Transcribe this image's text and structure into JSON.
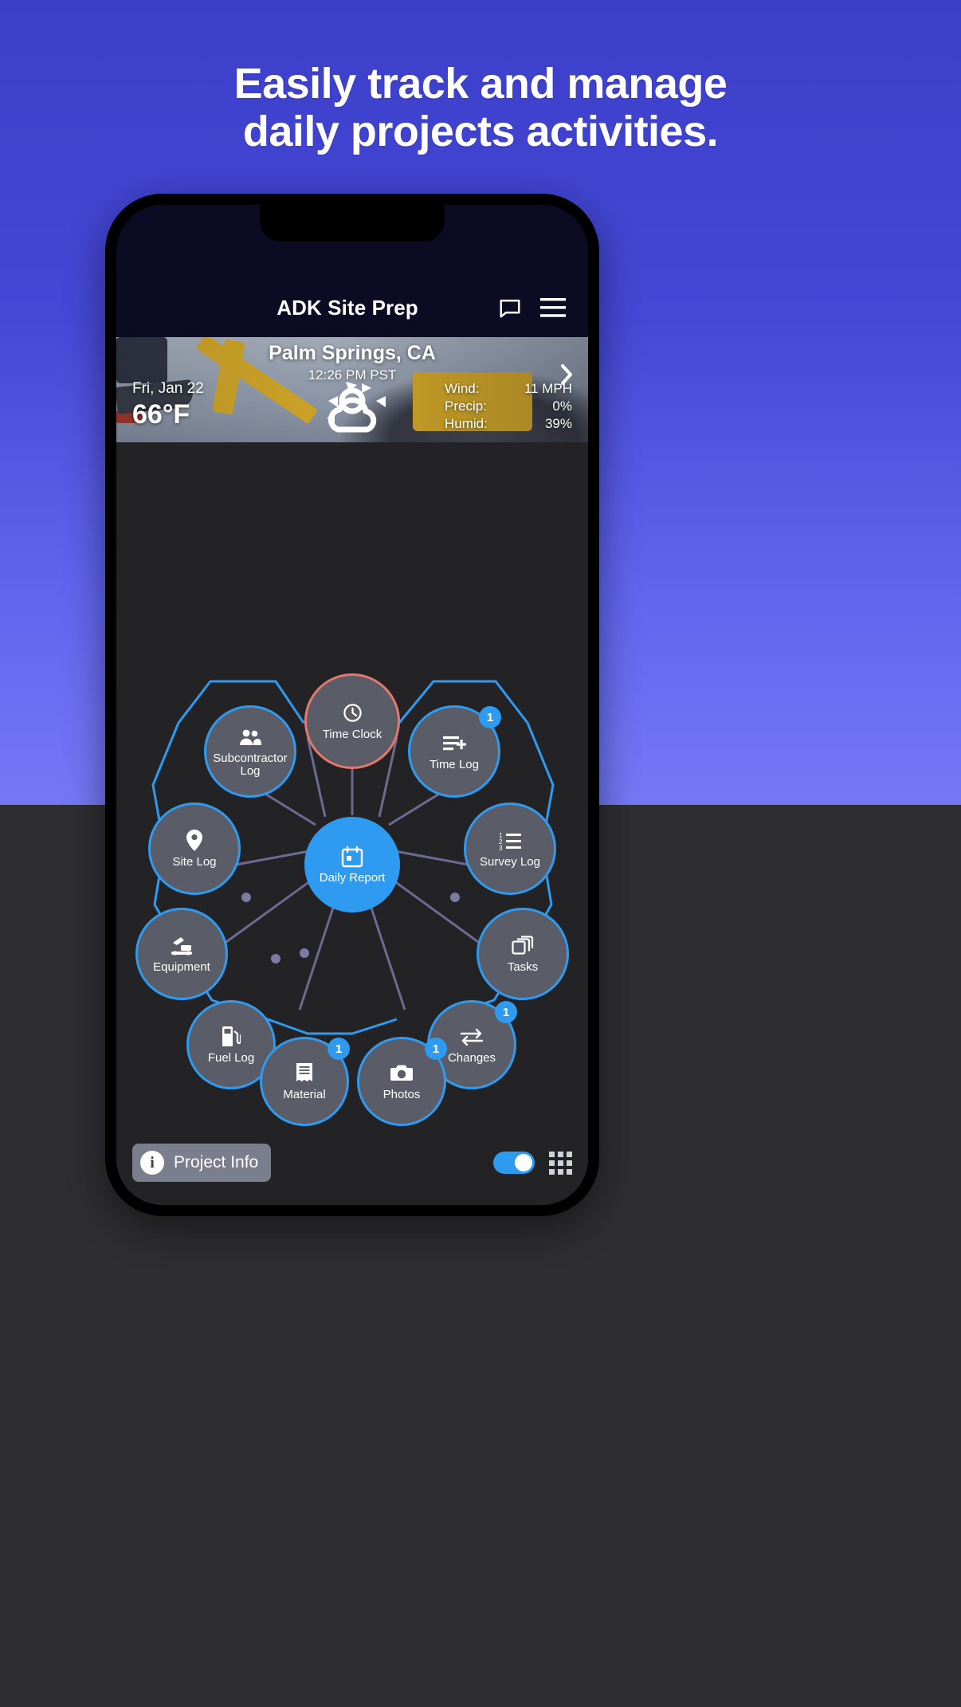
{
  "headline": {
    "line1": "Easily track and manage",
    "line2": "daily projects activities."
  },
  "app": {
    "title": "ADK Site Prep",
    "icons": {
      "message": "message-icon",
      "menu": "hamburger-menu-icon"
    }
  },
  "weather": {
    "city": "Palm Springs, CA",
    "time": "12:26 PM PST",
    "date": "Fri, Jan 22",
    "temperature": "66°F",
    "condition_icon": "partly-cloudy-icon",
    "chevron_icon": "chevron-right-icon",
    "stats": [
      {
        "label": "Wind:",
        "value": "11 MPH"
      },
      {
        "label": "Precip:",
        "value": "0%"
      },
      {
        "label": "Humid:",
        "value": "39%"
      }
    ]
  },
  "menu": {
    "center": {
      "label": "Daily Report",
      "icon": "calendar-icon"
    },
    "nodes": [
      {
        "label": "Time Clock",
        "icon": "clock-icon",
        "badge": null,
        "accent": true
      },
      {
        "label": "Time Log",
        "icon": "list-plus-icon",
        "badge": "1",
        "accent": false
      },
      {
        "label": "Survey Log",
        "icon": "ordered-list-icon",
        "badge": null,
        "accent": false
      },
      {
        "label": "Tasks",
        "icon": "layers-icon",
        "badge": null,
        "accent": false
      },
      {
        "label": "Changes",
        "icon": "exchange-icon",
        "badge": "1",
        "accent": false
      },
      {
        "label": "Photos",
        "icon": "camera-icon",
        "badge": "1",
        "accent": false
      },
      {
        "label": "Material",
        "icon": "receipt-icon",
        "badge": "1",
        "accent": false
      },
      {
        "label": "Fuel Log",
        "icon": "fuel-pump-icon",
        "badge": null,
        "accent": false
      },
      {
        "label": "Equipment",
        "icon": "excavator-icon",
        "badge": null,
        "accent": false
      },
      {
        "label": "Site Log",
        "icon": "map-pin-icon",
        "badge": null,
        "accent": false
      },
      {
        "label": "Subcontractor Log",
        "icon": "people-icon",
        "badge": null,
        "accent": false
      }
    ]
  },
  "bottom_bar": {
    "project_info_label": "Project Info",
    "info_glyph": "i",
    "toggle_on": true,
    "grid_icon": "grid-icon"
  },
  "colors": {
    "brand_purple": "#4548d6",
    "accent_blue": "#2e9bf0",
    "accent_red": "#e4786e",
    "node_fill": "#5a5d68",
    "canvas_bg": "#232326",
    "appbar_bg": "#0b0b24"
  }
}
